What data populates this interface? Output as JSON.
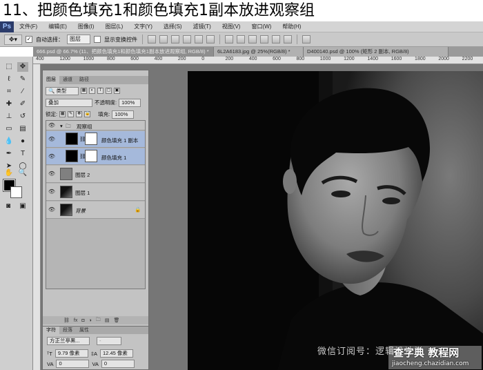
{
  "step_title": "11、把颜色填充1和颜色填充1副本放进观察组",
  "app": {
    "logo": "Ps",
    "menu": [
      "文件(F)",
      "编辑(E)",
      "图像(I)",
      "图层(L)",
      "文字(Y)",
      "选择(S)",
      "滤镜(T)",
      "视图(V)",
      "窗口(W)",
      "帮助(H)"
    ]
  },
  "options_bar": {
    "tool_icon": "move-icon",
    "auto_select_label": "自动选择：",
    "auto_select_value": "图层",
    "show_transform_label": "显示变换控件"
  },
  "doc_tabs": [
    "666.psd @ 66.7% (11、把颜色填充1和颜色填充1副本放进观察组, RGB/8) *",
    "6L2A6183.jpg @ 25%(RGB/8) *",
    "D400140.psd @ 100% (矩形 2 副本, RGB/8)"
  ],
  "ruler": {
    "top_ticks": [
      "400",
      "1200",
      "1000",
      "800",
      "600",
      "400",
      "200",
      "0",
      "200",
      "400",
      "600",
      "800",
      "1000",
      "1200",
      "1400",
      "1600",
      "1800",
      "2000",
      "2200"
    ]
  },
  "layers_panel": {
    "tabs": [
      "图层",
      "通道",
      "路径"
    ],
    "filter_label": "类型",
    "blend_mode": "叠加",
    "opacity_label": "不透明度:",
    "opacity_value": "100%",
    "lock_label": "锁定:",
    "fill_label": "填充:",
    "fill_value": "100%",
    "layers": [
      {
        "name": "观察组",
        "type": "group",
        "selected": false
      },
      {
        "name": "颜色填充 1 副本",
        "type": "fill",
        "selected": true
      },
      {
        "name": "颜色填充 1",
        "type": "fill",
        "selected": true
      },
      {
        "name": "图层 2",
        "type": "gray",
        "selected": false
      },
      {
        "name": "图层 1",
        "type": "photo",
        "selected": false
      },
      {
        "name": "背景",
        "type": "photo",
        "selected": false,
        "locked": true
      }
    ],
    "footer_icons": [
      "link-icon",
      "fx-icon",
      "mask-icon",
      "adjustment-icon",
      "folder-icon",
      "new-layer-icon",
      "trash-icon"
    ]
  },
  "character_panel": {
    "tabs": [
      "字符",
      "段落",
      "属性"
    ],
    "font_family": "方正兰亭黑...",
    "font_style": "-",
    "font_size": "9.79 像素",
    "leading": "12.45 像素",
    "tracking_left": "0",
    "tracking_right": "0"
  },
  "watermark": "微信订阅号：逻辑设计学",
  "site": {
    "title": "查字典 教程网",
    "url": "jiaocheng.chazidian.com"
  },
  "colors": {
    "selected_layer": "#a5b9db",
    "workspace": "#767676",
    "canvas_bg": "#050505"
  }
}
